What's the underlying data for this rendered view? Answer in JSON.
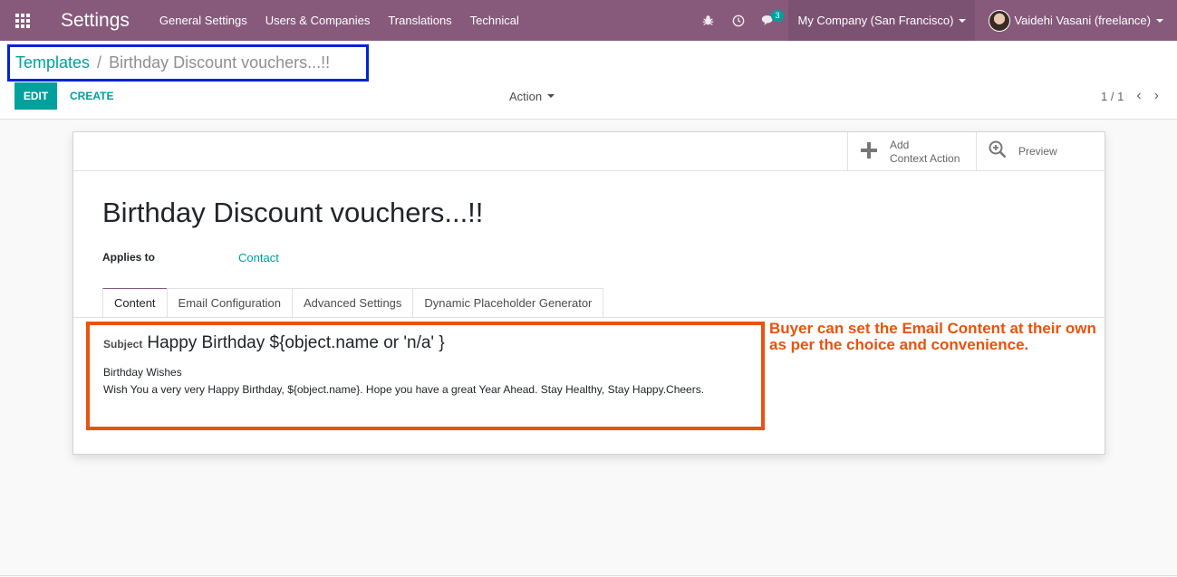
{
  "navbar": {
    "app_title": "Settings",
    "menu": [
      "General Settings",
      "Users & Companies",
      "Translations",
      "Technical"
    ],
    "icons": [
      "bug-icon",
      "clock-icon",
      "chat-icon"
    ],
    "chat_badge": "3",
    "company": "My Company (San Francisco)",
    "user": "Vaidehi Vasani (freelance)",
    "accent_color": "#875a7b"
  },
  "control": {
    "breadcrumb_parent": "Templates",
    "breadcrumb_separator": "/",
    "breadcrumb_current": "Birthday Discount vouchers...!!",
    "edit_label": "EDIT",
    "create_label": "CREATE",
    "action_label": "Action",
    "pager": "1 / 1"
  },
  "form": {
    "add_context_action_line1": "Add",
    "add_context_action_line2": "Context Action",
    "preview_label": "Preview",
    "title": "Birthday Discount vouchers...!!",
    "applies_to_label": "Applies to",
    "applies_to_value": "Contact",
    "tabs": [
      "Content",
      "Email Configuration",
      "Advanced Settings",
      "Dynamic Placeholder Generator"
    ],
    "subject_label": "Subject",
    "subject_value": "Happy Birthday ${object.name or 'n/a' }",
    "body_line1": "Birthday Wishes",
    "body_line2": "Wish You a very very Happy Birthday, ${object.name}. Hope you have a great Year Ahead. Stay Healthy, Stay Happy.Cheers."
  },
  "annotation": {
    "text": "Buyer can set the Email Content at their own as per the choice and convenience.",
    "color": "#e8530e"
  }
}
